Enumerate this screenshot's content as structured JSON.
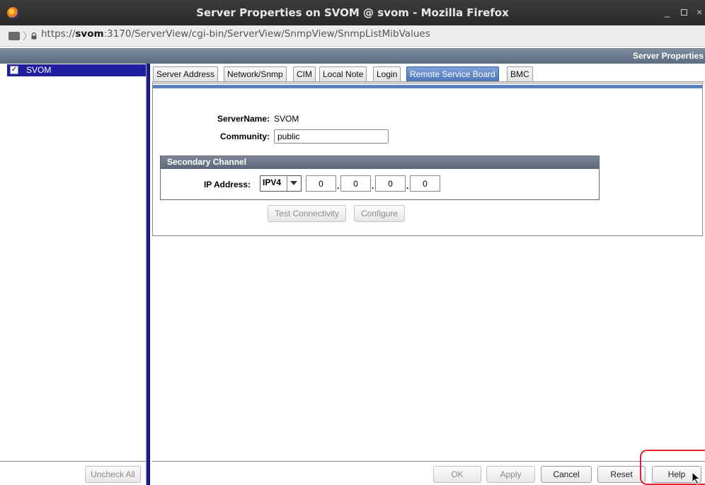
{
  "window": {
    "title": "Server Properties on SVOM @ svom - Mozilla Firefox",
    "minimize": "_",
    "close": "×"
  },
  "address_bar": {
    "url_scheme": "https://",
    "url_host": "svom",
    "url_rest": ":3170/ServerView/cgi-bin/ServerView/SnmpView/SnmpListMibValues",
    "chevron": "〉"
  },
  "header": {
    "title": "Server Properties"
  },
  "tree": {
    "items": [
      {
        "label": "SVOM",
        "checked": true,
        "check_glyph": "✓"
      }
    ],
    "uncheck_all_label": "Uncheck All"
  },
  "tabs": [
    {
      "label": "Server Address",
      "active": false
    },
    {
      "label": "Network/Snmp",
      "active": false
    },
    {
      "label": "CIM",
      "active": false
    },
    {
      "label": "Local Note",
      "active": false
    },
    {
      "label": "Login",
      "active": false
    },
    {
      "label": "Remote Service Board",
      "active": true
    },
    {
      "label": "BMC",
      "active": false
    }
  ],
  "form": {
    "server_name_label": "ServerName:",
    "server_name_value": "SVOM",
    "community_label": "Community:",
    "community_value": "public",
    "secondary_channel": {
      "title": "Secondary Channel",
      "ip_address_label": "IP Address:",
      "ip_version": "IPV4",
      "octets": [
        "0",
        "0",
        "0",
        "0"
      ],
      "dot": "."
    },
    "test_connectivity_label": "Test Connectivity",
    "configure_label": "Configure"
  },
  "footer": {
    "ok_label": "OK",
    "apply_label": "Apply",
    "cancel_label": "Cancel",
    "reset_label": "Reset",
    "help_label": "Help"
  },
  "colors": {
    "selection": "#1e1e9e",
    "active_tab": "#4a74b8",
    "header_band": "#5d6b7e",
    "annotation": "#e0242e"
  }
}
